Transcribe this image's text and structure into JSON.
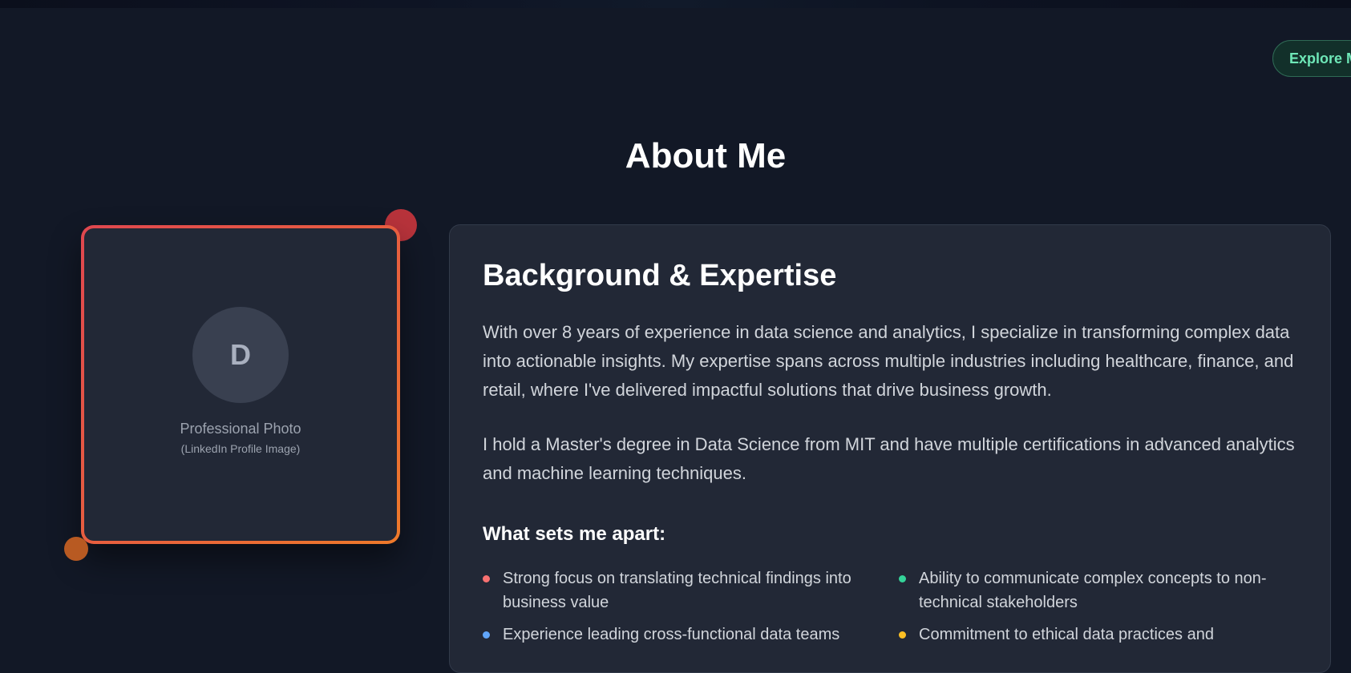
{
  "header": {
    "explore_label": "Explore M"
  },
  "section": {
    "title": "About Me"
  },
  "photo": {
    "initial": "D",
    "caption": "Professional Photo",
    "subcaption": "(LinkedIn Profile Image)"
  },
  "about": {
    "heading": "Background & Expertise",
    "paragraphs": [
      "With over 8 years of experience in data science and analytics, I specialize in transforming complex data into actionable insights. My expertise spans across multiple industries including healthcare, finance, and retail, where I've delivered impactful solutions that drive business growth.",
      "I hold a Master's degree in Data Science from MIT and have multiple certifications in advanced analytics and machine learning techniques."
    ],
    "apart_heading": "What sets me apart:",
    "features": [
      {
        "text": "Strong focus on translating technical findings into business value",
        "color": "#f87171"
      },
      {
        "text": "Ability to communicate complex concepts to non-technical stakeholders",
        "color": "#34d399"
      },
      {
        "text": "Experience leading cross-functional data teams",
        "color": "#60a5fa"
      },
      {
        "text": "Commitment to ethical data practices and",
        "color": "#fbbf24"
      }
    ]
  }
}
